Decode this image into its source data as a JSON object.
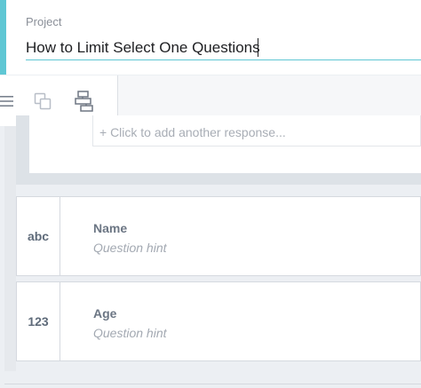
{
  "project": {
    "label": "Project",
    "title_value": "How to Limit Select One Questions"
  },
  "toolbar": {
    "icons": [
      "menu-icon",
      "copy-icon",
      "logic-flow-icon"
    ]
  },
  "choices": {
    "add_response": "+ Click to add another response..."
  },
  "questions": [
    {
      "type_badge": "abc",
      "label": "Name",
      "hint": "Question hint"
    },
    {
      "type_badge": "123",
      "label": "Age",
      "hint": "Question hint"
    }
  ],
  "colors": {
    "accent": "#5fc7d4",
    "background": "#eceff3"
  }
}
